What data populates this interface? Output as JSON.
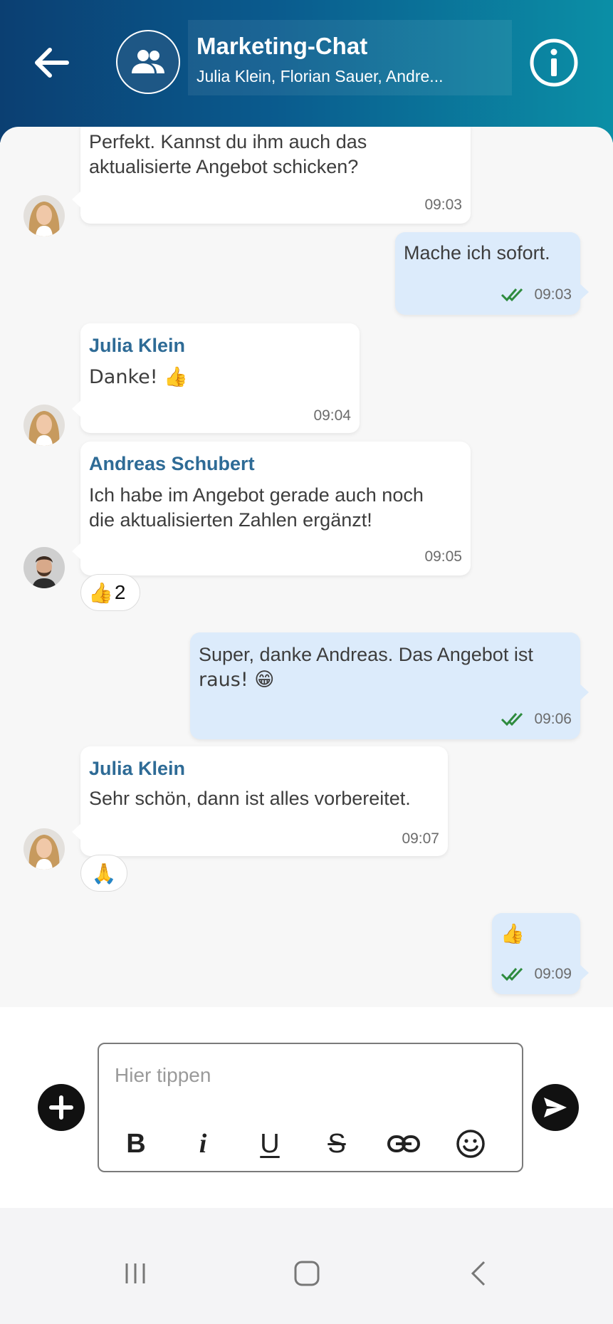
{
  "header": {
    "title": "Marketing-Chat",
    "members": "Julia Klein, Florian Sauer, Andre...",
    "back_icon": "arrow-left-icon",
    "group_icon": "group-icon",
    "info_icon": "info-icon",
    "colors": {
      "gradient_start": "#0b3f72",
      "gradient_end": "#0b8fa6"
    }
  },
  "messages": [
    {
      "direction": "in",
      "sender": "",
      "avatar": "julia-klein",
      "lines": [
        "Perfekt. Kannst du ihm auch das",
        "aktualisierte Angebot schicken?"
      ],
      "time": "09:03"
    },
    {
      "direction": "out",
      "lines": [
        "Mache ich sofort."
      ],
      "time": "09:03",
      "status": "read"
    },
    {
      "direction": "in",
      "sender": "Julia Klein",
      "avatar": "julia-klein",
      "lines": [
        "Danke! 👍"
      ],
      "time": "09:04"
    },
    {
      "direction": "in",
      "sender": "Andreas Schubert",
      "avatar": "andreas-schubert",
      "lines": [
        "Ich habe im Angebot gerade auch noch",
        "die aktualisierten Zahlen ergänzt!"
      ],
      "time": "09:05",
      "reaction": {
        "emoji": "👍",
        "count": "2"
      }
    },
    {
      "direction": "out",
      "lines": [
        "Super, danke Andreas. Das Angebot ist",
        "raus! 😁"
      ],
      "time": "09:06",
      "status": "read"
    },
    {
      "direction": "in",
      "sender": "Julia Klein",
      "avatar": "julia-klein",
      "lines": [
        "Sehr schön, dann ist alles vorbereitet."
      ],
      "time": "09:07",
      "reaction": {
        "emoji": "🙏",
        "count": ""
      }
    },
    {
      "direction": "out",
      "lines": [
        "👍"
      ],
      "time": "09:09",
      "status": "read"
    }
  ],
  "composer": {
    "placeholder": "Hier tippen",
    "add_icon": "plus-circle-icon",
    "send_icon": "send-icon",
    "format_buttons": [
      {
        "icon": "bold-icon",
        "label": "B"
      },
      {
        "icon": "italic-icon",
        "label": "i"
      },
      {
        "icon": "underline-icon",
        "label": "U"
      },
      {
        "icon": "strikethrough-icon",
        "label": "S"
      },
      {
        "icon": "link-icon",
        "label": ""
      },
      {
        "icon": "emoji-icon",
        "label": ""
      }
    ]
  },
  "navbar": {
    "recents_icon": "recents-icon",
    "home_icon": "home-icon",
    "back_icon": "back-chevron-icon"
  },
  "colors": {
    "incoming_bubble": "#ffffff",
    "outgoing_bubble": "#dcebfb",
    "sender_name": "#2e6b96",
    "read_ticks": "#2e8b3e"
  }
}
